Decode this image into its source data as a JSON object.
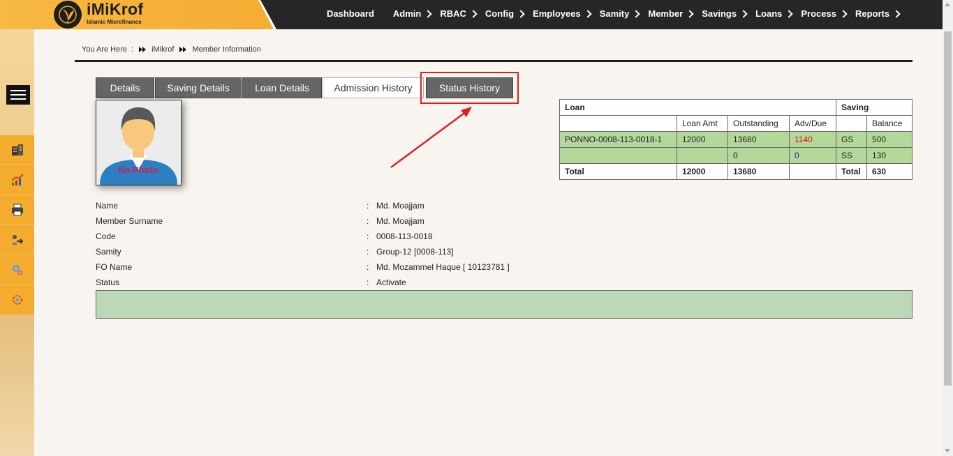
{
  "app": {
    "name": "iMiKrof",
    "subtitle": "Islamic Microfinance"
  },
  "nav": {
    "items": [
      {
        "label": "Dashboard",
        "chevron": false
      },
      {
        "label": "Admin",
        "chevron": true
      },
      {
        "label": "RBAC",
        "chevron": true
      },
      {
        "label": "Config",
        "chevron": true
      },
      {
        "label": "Employees",
        "chevron": true
      },
      {
        "label": "Samity",
        "chevron": true
      },
      {
        "label": "Member",
        "chevron": true
      },
      {
        "label": "Savings",
        "chevron": true
      },
      {
        "label": "Loans",
        "chevron": true
      },
      {
        "label": "Process",
        "chevron": true
      },
      {
        "label": "Reports",
        "chevron": true
      }
    ]
  },
  "sidebar": {
    "icons": [
      "building-icon",
      "chart-growth-icon",
      "printer-icon",
      "transfer-icon",
      "gears-icon",
      "settings-icon"
    ]
  },
  "breadcrumb": {
    "prefix": "You Are Here",
    "separator": ":",
    "items": [
      "iMikrof",
      "Member Information"
    ]
  },
  "tabs": [
    {
      "label": "Details",
      "active": false
    },
    {
      "label": "Saving Details",
      "active": false
    },
    {
      "label": "Loan Details",
      "active": false
    },
    {
      "label": "Admission History",
      "active": true
    },
    {
      "label": "Status History",
      "active": false
    }
  ],
  "photo": {
    "placeholder_text": "No Photo"
  },
  "summary": {
    "loan_header": "Loan",
    "saving_header": "Saving",
    "columns": {
      "loan_amt": "Loan Amt",
      "outstanding": "Outstanding",
      "adv_due": "Adv/Due",
      "balance": "Balance"
    },
    "rows": [
      {
        "loan_code": "PONNO-0008-113-0018-1",
        "loan_amt": "12000",
        "outstanding": "13680",
        "adv_due": "1140",
        "saving_type": "GS",
        "balance": "500"
      },
      {
        "loan_code": "",
        "loan_amt": "",
        "outstanding": "0",
        "adv_due": "0",
        "saving_type": "SS",
        "balance": "130"
      }
    ],
    "total": {
      "label": "Total",
      "loan_amt": "12000",
      "outstanding": "13680",
      "adv_due": "",
      "saving_label": "Total",
      "balance": "630"
    }
  },
  "member": {
    "fields": [
      {
        "label": "Name",
        "value": "Md. Moajjam"
      },
      {
        "label": "Member Surname",
        "value": "Md. Moajjam"
      },
      {
        "label": "Code",
        "value": "0008-113-0018"
      },
      {
        "label": "Samity",
        "value": "Group-12 [0008-113]"
      },
      {
        "label": "FO Name",
        "value": "Md. Mozammel Haque [ 10123781 ]"
      },
      {
        "label": "Status",
        "value": "Activate"
      }
    ],
    "colon": ":"
  },
  "colors": {
    "brand": "#f4ad33",
    "topbar": "#262626",
    "tab_inactive": "#666666",
    "row_green": "#b4d89a",
    "highlight": "#e02020"
  }
}
